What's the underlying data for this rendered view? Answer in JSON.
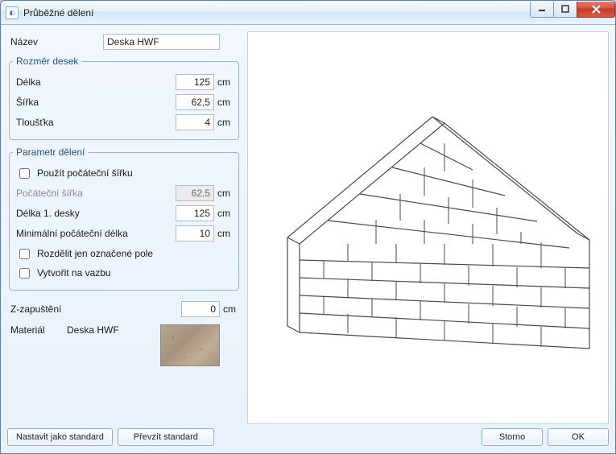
{
  "window": {
    "title": "Průběžné dělení"
  },
  "name": {
    "label": "Název",
    "value": "Deska HWF"
  },
  "board_size": {
    "legend": "Rozměr desek",
    "length_label": "Délka",
    "length_value": "125",
    "length_unit": "cm",
    "width_label": "Šířka",
    "width_value": "62,5",
    "width_unit": "cm",
    "thickness_label": "Tloušťka",
    "thickness_value": "4",
    "thickness_unit": "cm"
  },
  "division": {
    "legend": "Parametr dělení",
    "use_initial_width_label": "Použít počáteční šířku",
    "use_initial_width_checked": false,
    "initial_width_label": "Počáteční šířka",
    "initial_width_value": "62,5",
    "initial_width_unit": "cm",
    "first_board_length_label": "Délka 1. desky",
    "first_board_length_value": "125",
    "first_board_length_unit": "cm",
    "min_initial_length_label": "Minimální počáteční délka",
    "min_initial_length_value": "10",
    "min_initial_length_unit": "cm",
    "split_marked_only_label": "Rozdělit jen označené pole",
    "split_marked_only_checked": false,
    "create_bond_label": "Vytvořit na vazbu",
    "create_bond_checked": false
  },
  "z_recess": {
    "label": "Z-zapuštění",
    "value": "0",
    "unit": "cm"
  },
  "material": {
    "label": "Materiál",
    "value": "Deska HWF"
  },
  "buttons": {
    "set_standard": "Nastavit jako standard",
    "take_standard": "Převzít standard",
    "cancel": "Storno",
    "ok": "OK"
  }
}
